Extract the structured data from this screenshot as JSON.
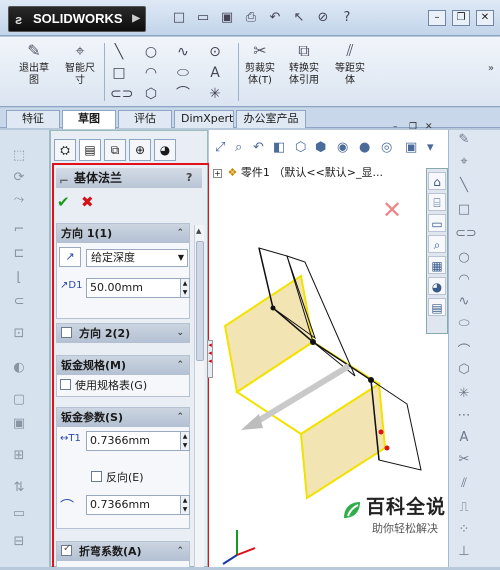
{
  "app": {
    "name": "SOLIDWORKS",
    "brand_color": "#111111",
    "accent_color": "#e1101a"
  },
  "ribbon": {
    "buttons": [
      {
        "label": "退出草\n图",
        "icon": "exit-sketch-icon"
      },
      {
        "label": "智能尺\n寸",
        "icon": "smart-dimension-icon"
      },
      {
        "label": "剪裁实\n体(T)",
        "icon": "trim-entities-icon"
      },
      {
        "label": "转换实\n体引用",
        "icon": "convert-entities-icon"
      },
      {
        "label": "等距实\n体",
        "icon": "offset-entities-icon"
      }
    ]
  },
  "tabs": [
    {
      "label": "特征"
    },
    {
      "label": "草图"
    },
    {
      "label": "评估"
    },
    {
      "label": "DimXpert"
    },
    {
      "label": "办公室产品"
    }
  ],
  "property_manager": {
    "title": "基体法兰",
    "help": "?",
    "groups": {
      "direction1": {
        "title": "方向 1(1)",
        "end_condition": "给定深度",
        "depth": "50.00mm"
      },
      "direction2": {
        "title": "方向 2(2)",
        "checked": false
      },
      "gauge": {
        "title": "钣金规格(M)",
        "use_table_label": "使用规格表(G)"
      },
      "params": {
        "title": "钣金参数(S)",
        "thickness": "0.7366mm",
        "reverse_label": "反向(E)",
        "radius": "0.7366mm"
      },
      "bend": {
        "title": "折弯系数(A)",
        "checked": true
      }
    }
  },
  "feature_tree": {
    "root_label": "零件1 （默认<<默认>_显..."
  },
  "watermark": {
    "title": "百科全说",
    "subtitle": "助你轻松解决"
  }
}
